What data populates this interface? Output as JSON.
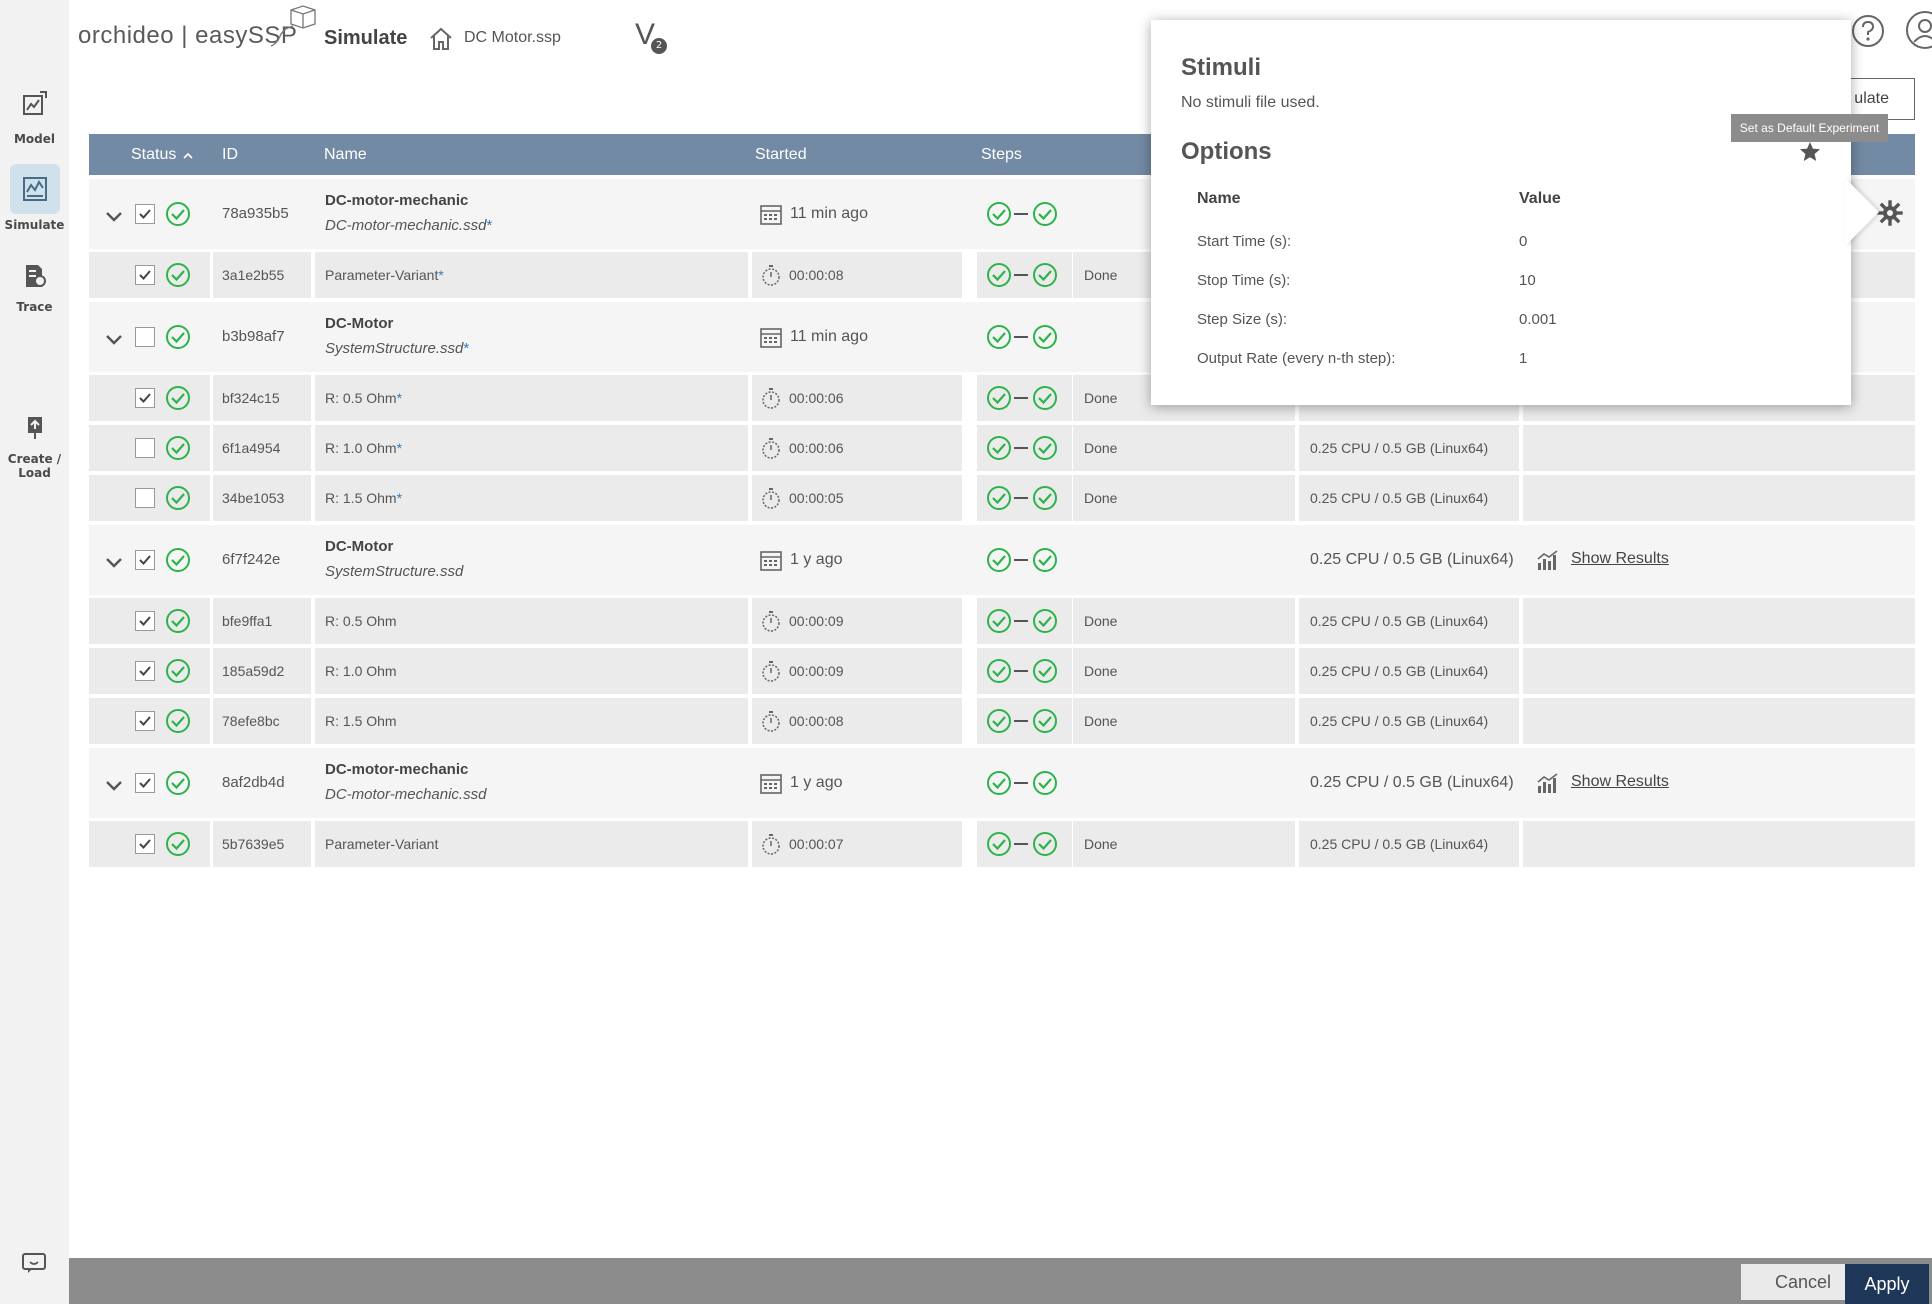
{
  "header": {
    "brand": "orchideo | easySSP",
    "page_title": "Simulate",
    "file_name": "DC Motor.ssp",
    "version_letter": "V",
    "version_number": "2",
    "simulate_button": "ulate"
  },
  "sidebar": {
    "items": [
      {
        "label": "Model",
        "icon": "model-icon"
      },
      {
        "label": "Simulate",
        "icon": "simulate-icon"
      },
      {
        "label": "Trace",
        "icon": "trace-icon"
      },
      {
        "label_line1": "Create /",
        "label_line2": "Load",
        "icon": "create-load-icon"
      }
    ]
  },
  "table": {
    "headers": {
      "status": "Status",
      "sort_arrow": "^",
      "id": "ID",
      "name": "Name",
      "started": "Started",
      "steps": "Steps"
    },
    "groups": [
      {
        "id": "78a935b5",
        "name": "DC-motor-mechanic",
        "file": "DC-motor-mechanic.ssd",
        "modified": "*",
        "started": "11 min ago",
        "checked": true,
        "resources": "",
        "results": "",
        "children": [
          {
            "id": "3a1e2b55",
            "name": "Parameter-Variant",
            "modified": "*",
            "duration": "00:00:08",
            "state": "Done",
            "checked": true,
            "resources": ""
          }
        ]
      },
      {
        "id": "b3b98af7",
        "name": "DC-Motor",
        "file": "SystemStructure.ssd",
        "modified": "*",
        "started": "11 min ago",
        "checked": false,
        "resources": "",
        "results": "",
        "children": [
          {
            "id": "bf324c15",
            "name": "R: 0.5 Ohm",
            "modified": "*",
            "duration": "00:00:06",
            "state": "Done",
            "checked": true,
            "resources": ""
          },
          {
            "id": "6f1a4954",
            "name": "R: 1.0 Ohm",
            "modified": "*",
            "duration": "00:00:06",
            "state": "Done",
            "checked": false,
            "resources": "0.25 CPU / 0.5 GB (Linux64)"
          },
          {
            "id": "34be1053",
            "name": "R: 1.5 Ohm",
            "modified": "*",
            "duration": "00:00:05",
            "state": "Done",
            "checked": false,
            "resources": "0.25 CPU / 0.5 GB (Linux64)"
          }
        ]
      },
      {
        "id": "6f7f242e",
        "name": "DC-Motor",
        "file": "SystemStructure.ssd",
        "modified": "",
        "started": "1 y ago",
        "checked": true,
        "resources": "0.25 CPU / 0.5 GB (Linux64)",
        "results": "Show Results",
        "children": [
          {
            "id": "bfe9ffa1",
            "name": "R: 0.5 Ohm",
            "modified": "",
            "duration": "00:00:09",
            "state": "Done",
            "checked": true,
            "resources": "0.25 CPU / 0.5 GB (Linux64)"
          },
          {
            "id": "185a59d2",
            "name": "R: 1.0 Ohm",
            "modified": "",
            "duration": "00:00:09",
            "state": "Done",
            "checked": true,
            "resources": "0.25 CPU / 0.5 GB (Linux64)"
          },
          {
            "id": "78efe8bc",
            "name": "R: 1.5 Ohm",
            "modified": "",
            "duration": "00:00:08",
            "state": "Done",
            "checked": true,
            "resources": "0.25 CPU / 0.5 GB (Linux64)"
          }
        ]
      },
      {
        "id": "8af2db4d",
        "name": "DC-motor-mechanic",
        "file": "DC-motor-mechanic.ssd",
        "modified": "",
        "started": "1 y ago",
        "checked": true,
        "resources": "0.25 CPU / 0.5 GB (Linux64)",
        "results": "Show Results",
        "children": [
          {
            "id": "5b7639e5",
            "name": "Parameter-Variant",
            "modified": "",
            "duration": "00:00:07",
            "state": "Done",
            "checked": true,
            "resources": "0.25 CPU / 0.5 GB (Linux64)"
          }
        ]
      }
    ]
  },
  "popover": {
    "stimuli_title": "Stimuli",
    "stimuli_text": "No stimuli file used.",
    "options_title": "Options",
    "col_name": "Name",
    "col_value": "Value",
    "options": [
      {
        "name": "Start Time (s):",
        "value": "0"
      },
      {
        "name": "Stop Time (s):",
        "value": "10"
      },
      {
        "name": "Step Size (s):",
        "value": "0.001"
      },
      {
        "name": "Output Rate (every n-th step):",
        "value": "1"
      }
    ],
    "tooltip": "Set as Default Experiment"
  },
  "footer": {
    "cancel": "Cancel",
    "apply": "Apply"
  },
  "colors": {
    "header_bg": "#728aa3",
    "ok_green": "#2db34a",
    "apply_bg": "#1e3657",
    "footer_bg": "#8c8c8c"
  }
}
